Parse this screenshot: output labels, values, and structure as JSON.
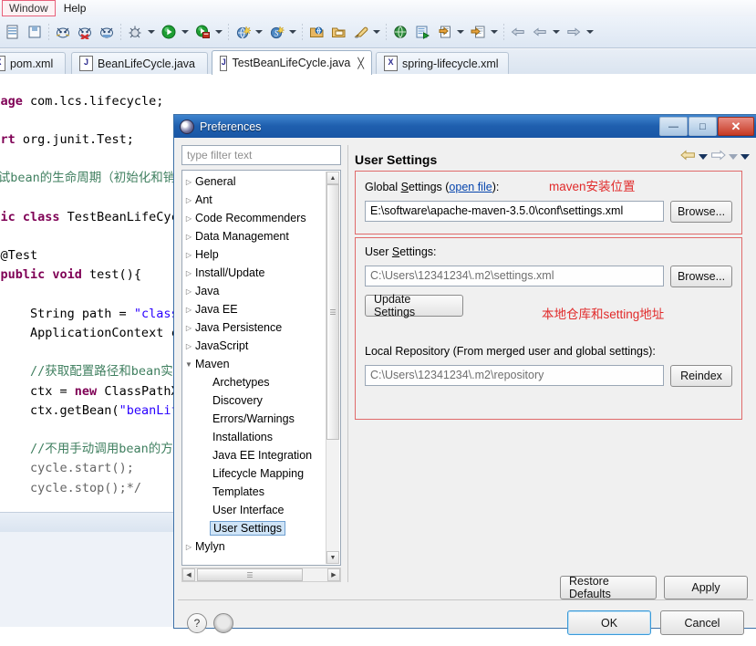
{
  "menubar": {
    "items": [
      {
        "label": "Window",
        "highlighted": true
      },
      {
        "label": "Help",
        "highlighted": false
      }
    ]
  },
  "toolbar": {
    "icons": [
      "new-wizard-icon",
      "save-icon",
      "print-icon",
      "debug-cat-icon",
      "run-cat-icon",
      "profile-cat-icon",
      "debug-bug-icon",
      "run-green-icon",
      "run-external-icon",
      "new-java-project-icon",
      "new-spring-icon",
      "open-type-icon",
      "open-task-icon",
      "search-icon",
      "globe-icon",
      "run-last-icon",
      "import-icon",
      "export-icon",
      "back-arrow-icon",
      "prev-edit-icon",
      "next-edit-icon"
    ]
  },
  "editor_tabs": [
    {
      "label": "pom.xml",
      "icon": "xml-file-icon",
      "active": false,
      "closable": false
    },
    {
      "label": "BeanLifeCycle.java",
      "icon": "java-file-icon",
      "active": false,
      "closable": false
    },
    {
      "label": "TestBeanLifeCycle.java",
      "icon": "java-file-icon",
      "active": true,
      "closable": true
    },
    {
      "label": "spring-lifecycle.xml",
      "icon": "xml-file-icon",
      "active": false,
      "closable": false
    }
  ],
  "code": {
    "lines": [
      "package com.lcs.lifecycle;",
      "",
      "import org.junit.Test;",
      "",
      "/*测试bean的生命周期（初始化和销毁）",
      "",
      "public class TestBeanLifeCycle {",
      "",
      "    @Test",
      "    public void test(){",
      "",
      "        String path = \"classpath:spring-lifecycle.xml\";",
      "        ApplicationContext ctx = new ClassPathXmlApplic",
      "",
      "        //获取配置路径和bean实例",
      "        ctx = new ClassPathXmlApplicationContext(path);",
      "        ctx.getBean(\"beanLifeCycle\");",
      "",
      "        //不用手动调用bean的方法",
      "        cycle.start();",
      "        cycle.stop();*/"
    ]
  },
  "dialog": {
    "title": "Preferences",
    "title_icon": "preferences-gear-icon",
    "window_buttons": [
      {
        "name": "minimize",
        "glyph": "—"
      },
      {
        "name": "maximize",
        "glyph": "□"
      },
      {
        "name": "close",
        "glyph": "✕"
      }
    ],
    "filter": {
      "placeholder": "type filter text",
      "value": ""
    },
    "tree": [
      {
        "label": "General",
        "level": 1,
        "expandable": true,
        "expanded": false,
        "selected": false
      },
      {
        "label": "Ant",
        "level": 1,
        "expandable": true,
        "expanded": false,
        "selected": false
      },
      {
        "label": "Code Recommenders",
        "level": 1,
        "expandable": true,
        "expanded": false,
        "selected": false
      },
      {
        "label": "Data Management",
        "level": 1,
        "expandable": true,
        "expanded": false,
        "selected": false
      },
      {
        "label": "Help",
        "level": 1,
        "expandable": true,
        "expanded": false,
        "selected": false
      },
      {
        "label": "Install/Update",
        "level": 1,
        "expandable": true,
        "expanded": false,
        "selected": false
      },
      {
        "label": "Java",
        "level": 1,
        "expandable": true,
        "expanded": false,
        "selected": false
      },
      {
        "label": "Java EE",
        "level": 1,
        "expandable": true,
        "expanded": false,
        "selected": false
      },
      {
        "label": "Java Persistence",
        "level": 1,
        "expandable": true,
        "expanded": false,
        "selected": false
      },
      {
        "label": "JavaScript",
        "level": 1,
        "expandable": true,
        "expanded": false,
        "selected": false
      },
      {
        "label": "Maven",
        "level": 1,
        "expandable": true,
        "expanded": true,
        "selected": false
      },
      {
        "label": "Archetypes",
        "level": 2,
        "expandable": false,
        "expanded": false,
        "selected": false
      },
      {
        "label": "Discovery",
        "level": 2,
        "expandable": false,
        "expanded": false,
        "selected": false
      },
      {
        "label": "Errors/Warnings",
        "level": 2,
        "expandable": false,
        "expanded": false,
        "selected": false
      },
      {
        "label": "Installations",
        "level": 2,
        "expandable": false,
        "expanded": false,
        "selected": false
      },
      {
        "label": "Java EE Integration",
        "level": 2,
        "expandable": false,
        "expanded": false,
        "selected": false
      },
      {
        "label": "Lifecycle Mapping",
        "level": 2,
        "expandable": false,
        "expanded": false,
        "selected": false
      },
      {
        "label": "Templates",
        "level": 2,
        "expandable": false,
        "expanded": false,
        "selected": false
      },
      {
        "label": "User Interface",
        "level": 2,
        "expandable": false,
        "expanded": false,
        "selected": false
      },
      {
        "label": "User Settings",
        "level": 2,
        "expandable": false,
        "expanded": false,
        "selected": true
      },
      {
        "label": "Mylyn",
        "level": 1,
        "expandable": true,
        "expanded": false,
        "selected": false
      }
    ],
    "page": {
      "title": "User Settings",
      "global_settings": {
        "label_pre": "Global ",
        "label_underlined": "S",
        "label_post": "ettings (",
        "link": "open file",
        "label_tail": "):",
        "value": "E:\\software\\apache-maven-3.5.0\\conf\\settings.xml",
        "browse_label": "Browse..."
      },
      "user_settings": {
        "label_pre": "User ",
        "label_underlined": "S",
        "label_post": "ettings:",
        "value": "C:\\Users\\12341234\\.m2\\settings.xml",
        "browse_label": "Browse...",
        "update_label": "Update Settings"
      },
      "local_repository": {
        "label": "Local Repository (From merged user and global settings):",
        "value": "C:\\Users\\12341234\\.m2\\repository",
        "reindex_label": "Reindex"
      },
      "annotations": [
        {
          "text": "maven安装位置",
          "color": "#e12b2b"
        },
        {
          "text": "本地仓库和setting地址",
          "color": "#e12b2b"
        }
      ]
    },
    "buttons": {
      "restore_defaults": "Restore Defaults",
      "apply": "Apply",
      "ok": "OK",
      "cancel": "Cancel",
      "help": "?",
      "extra": "◉"
    }
  }
}
